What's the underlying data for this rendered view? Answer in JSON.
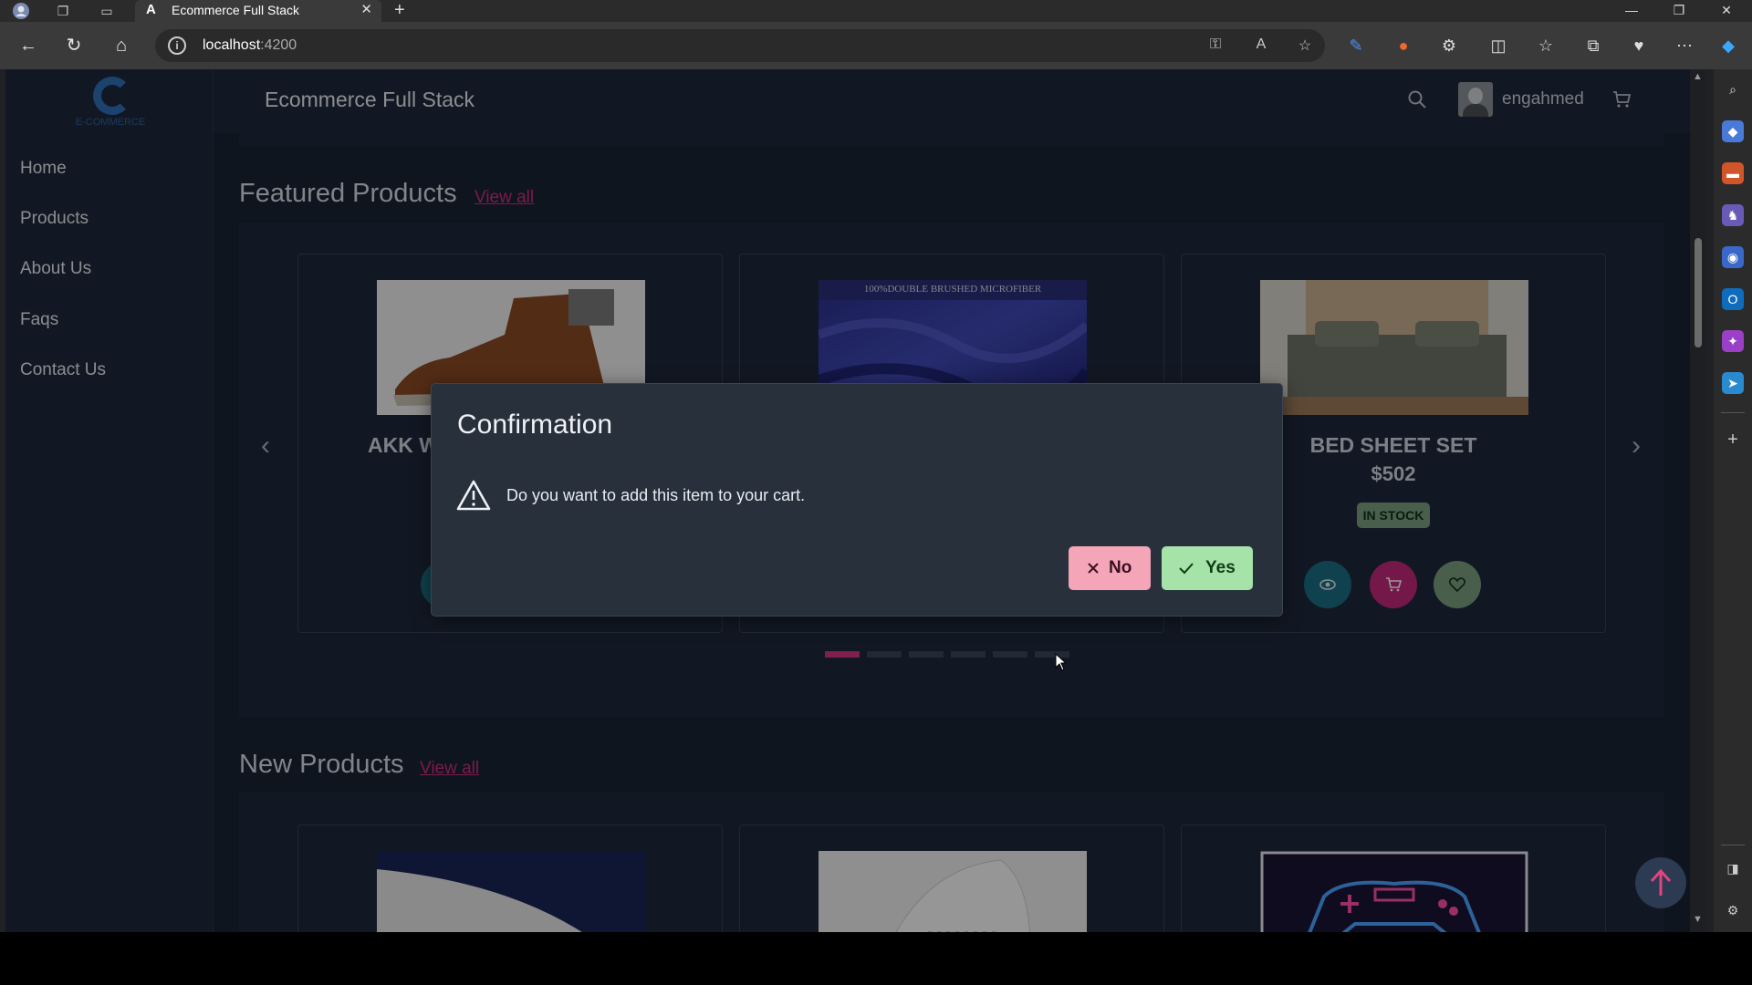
{
  "browser": {
    "tab_title": "Ecommerce Full Stack",
    "tab_favicon": "A",
    "url_host": "localhost",
    "url_port": ":4200"
  },
  "app": {
    "title": "Ecommerce Full Stack",
    "logo_text": "E-COMMERCE",
    "username": "engahmed"
  },
  "sidebar": {
    "items": [
      {
        "label": "Home"
      },
      {
        "label": "Products"
      },
      {
        "label": "About Us"
      },
      {
        "label": "Faqs"
      },
      {
        "label": "Contact Us"
      }
    ]
  },
  "featured": {
    "title": "Featured Products",
    "view_all": "View all",
    "cards": [
      {
        "name": "AKK W",
        "image": "brown-leather-boot"
      },
      {
        "name": "",
        "image": "blue-microfiber-sheet",
        "image_caption": "100%DOUBLE BRUSHED MICROFIBER"
      },
      {
        "name": "BED SHEET SET",
        "price": "$502",
        "status": "IN STOCK",
        "image": "grey-bed-sheet"
      }
    ],
    "indicators": 6,
    "active_indicator": 0
  },
  "new_products": {
    "title": "New Products",
    "view_all": "View all",
    "cards": [
      {
        "image": "navy-cap"
      },
      {
        "image": "white-sneaker"
      },
      {
        "image": "neon-gamepad"
      }
    ]
  },
  "dialog": {
    "title": "Confirmation",
    "message": "Do you want to add this item to your cart.",
    "no_label": "No",
    "yes_label": "Yes"
  },
  "colors": {
    "accent": "#d63384",
    "page_bg": "#1a2332",
    "panel_bg": "#1e293b",
    "no_button": "#f4a6b8",
    "yes_button": "#a6e3a9",
    "in_stock": "#7a9e7e"
  }
}
